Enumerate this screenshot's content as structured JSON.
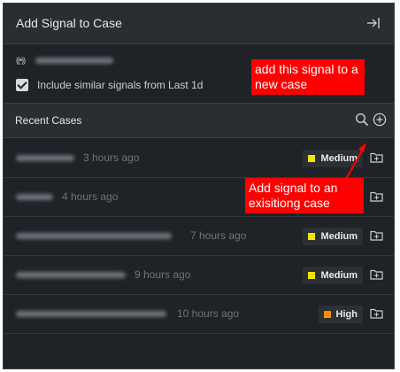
{
  "panel": {
    "title": "Add Signal to Case",
    "close_icon": "collapse-right-icon"
  },
  "signal": {
    "icon": "signal-broadcast-icon",
    "icon_glyph": "((•))"
  },
  "include_similar": {
    "checked": true,
    "label": "Include similar signals from Last 1d"
  },
  "recent_cases": {
    "label": "Recent Cases",
    "search_icon": "search-icon",
    "add_icon": "add-circle-icon",
    "items": [
      {
        "time": "3 hours ago",
        "severity": "Medium",
        "severity_color": "#f2e600"
      },
      {
        "time": "4 hours ago",
        "severity": "",
        "severity_color": ""
      },
      {
        "time": "7 hours ago",
        "severity": "Medium",
        "severity_color": "#f2e600"
      },
      {
        "time": "9 hours ago",
        "severity": "Medium",
        "severity_color": "#f2e600"
      },
      {
        "time": "10 hours ago",
        "severity": "High",
        "severity_color": "#ff8c00"
      }
    ]
  },
  "annotations": {
    "new_case": "add this signal to a new case",
    "existing_case": "Add signal to an exisitiong case",
    "color": "#ff0000"
  }
}
